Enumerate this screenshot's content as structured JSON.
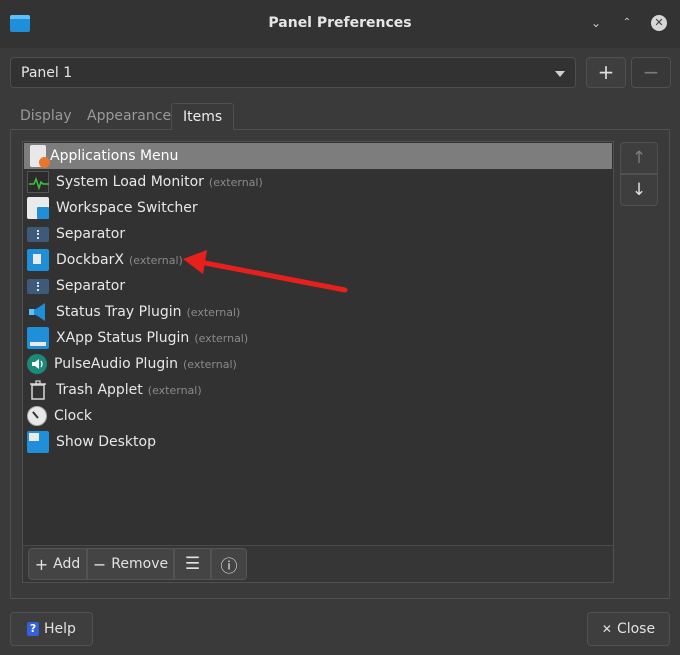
{
  "window": {
    "title": "Panel Preferences",
    "controls": {
      "minimize": "⌄",
      "maximize": "⌃",
      "close": "✕"
    }
  },
  "panel_selector": {
    "value": "Panel 1"
  },
  "panel_buttons": {
    "add": "+",
    "remove": "−"
  },
  "tabs": [
    {
      "label": "Display"
    },
    {
      "label": "Appearance"
    },
    {
      "label": "Items"
    }
  ],
  "items": [
    {
      "name": "Applications Menu",
      "ext": "",
      "icon": "applications-menu-icon"
    },
    {
      "name": "System Load Monitor",
      "ext": "(external)",
      "icon": "system-load-icon"
    },
    {
      "name": "Workspace Switcher",
      "ext": "",
      "icon": "workspace-switcher-icon"
    },
    {
      "name": "Separator",
      "ext": "",
      "icon": "separator-icon"
    },
    {
      "name": "DockbarX",
      "ext": "(external)",
      "icon": "dockbarx-icon"
    },
    {
      "name": "Separator",
      "ext": "",
      "icon": "separator-icon"
    },
    {
      "name": "Status Tray Plugin",
      "ext": "(external)",
      "icon": "status-tray-icon"
    },
    {
      "name": "XApp Status Plugin",
      "ext": "(external)",
      "icon": "xapp-status-icon"
    },
    {
      "name": "PulseAudio Plugin",
      "ext": "(external)",
      "icon": "pulseaudio-icon"
    },
    {
      "name": "Trash Applet",
      "ext": "(external)",
      "icon": "trash-icon"
    },
    {
      "name": "Clock",
      "ext": "",
      "icon": "clock-icon"
    },
    {
      "name": "Show Desktop",
      "ext": "",
      "icon": "show-desktop-icon"
    }
  ],
  "move_buttons": {
    "up": "↑",
    "down": "↓"
  },
  "toolbar": {
    "add_label": "Add",
    "remove_label": "Remove",
    "add_glyph": "+",
    "remove_glyph": "−",
    "list_glyph": "☰",
    "info_glyph": "ⓘ"
  },
  "footer": {
    "help_label": "Help",
    "help_glyph": "?",
    "close_label": "Close",
    "close_glyph": "✕"
  },
  "colors": {
    "selection": "#7d7d7d",
    "accent_blue": "#1e8fd8",
    "annotation_arrow": "#e8201c"
  }
}
